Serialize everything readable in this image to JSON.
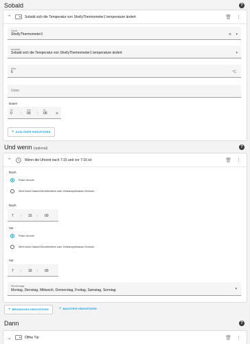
{
  "sections": {
    "when_title": "Sobald",
    "and_if_title": "Und wenn",
    "and_if_optional": "(optional)",
    "then_title": "Dann"
  },
  "trigger": {
    "header_title": "Sobald sich die Temperatur von ShellyThermometer1 temperature ändert",
    "device_label": "Gerät",
    "device_value": "ShellyThermometer1",
    "trigger_label": "Auslöser",
    "trigger_value": "Sobald sich die Temperatur von ShellyThermometer1 temperature ändert",
    "above_label": "Über",
    "above_value": "5",
    "above_unit": "°C",
    "below_label": "Unter",
    "duration_label": "Dauer",
    "duration": {
      "h_label": "hh",
      "m_label": "mm",
      "s_label": "ss",
      "h": "0",
      "m": "00",
      "s": "00"
    },
    "add_button": "AUSLÖSER HINZUFÜGEN"
  },
  "condition": {
    "header_title": "Wenn die Uhrzeit nach 7:15 und vor 7:16 ist",
    "after_label": "Nach",
    "option_fixed": "Feste Uhrzeit",
    "option_entity": "Wert eines Datum/Uhrzeithelfers oder Zeitstempelklasse-Sensors",
    "after_time": {
      "h": "7",
      "m": "15",
      "s": "00"
    },
    "before_label": "Vor",
    "before_time": {
      "h": "7",
      "m": "16",
      "s": "00"
    },
    "weekday_label": "Wochentage",
    "weekday_value": "Montag, Dienstag, Mittwoch, Donnerstag, Freitag, Samstag, Sonntag",
    "add_condition_button": "BEDINGUNG HINZUFÜGEN",
    "add_block_button": "BAUSTEIN HINZUFÜGEN"
  },
  "action": {
    "header_title": "Öffne Tür"
  },
  "icons": {
    "trigger": "device-icon",
    "condition": "clock-icon",
    "action": "device-icon",
    "menu": "kebab-menu-icon",
    "delete": "trash-icon",
    "clear": "close-icon",
    "help": "help-icon"
  },
  "colors": {
    "accent": "#039be5",
    "background": "#f3f3f3",
    "card": "#ffffff",
    "help_icon": "#3a3a3a"
  }
}
